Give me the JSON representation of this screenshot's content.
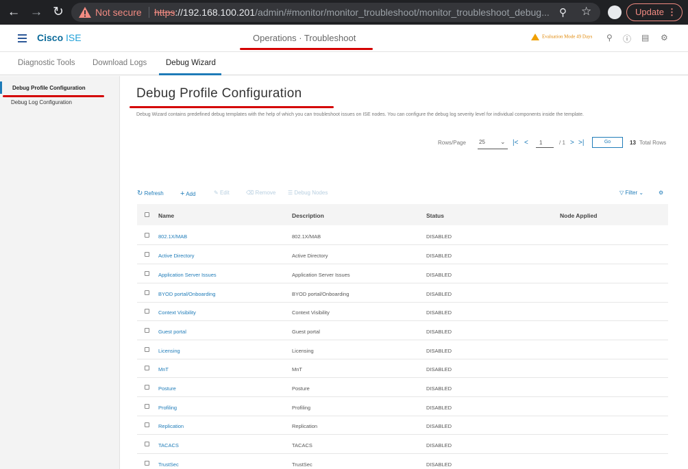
{
  "browser": {
    "security_label": "Not secure",
    "url_scheme": "https",
    "url_host": "://192.168.100.201",
    "url_path": "/admin/#monitor/monitor_troubleshoot/monitor_troubleshoot_debug...",
    "update_label": "Update"
  },
  "app": {
    "brand_cisco": "Cisco",
    "brand_product": "ISE",
    "page_heading": "Operations · Troubleshoot",
    "evaluation_notice": "Evaluation Mode 49 Days"
  },
  "subnav": {
    "tabs": [
      "Diagnostic Tools",
      "Download Logs",
      "Debug Wizard"
    ],
    "active_tab": "Debug Wizard"
  },
  "sidebar": {
    "items": [
      "Debug Profile Configuration",
      "Debug Log Configuration"
    ]
  },
  "main": {
    "title": "Debug Profile Configuration",
    "description": "Debug Wizard contains predefined debug templates with the help of which you can troubleshoot issues on ISE nodes. You can configure the debug log severity level for individual components inside the template."
  },
  "pager": {
    "rows_label": "Rows/Page",
    "rows_value": "25",
    "page_value": "1",
    "page_total": "/ 1",
    "go_label": "Go",
    "total_rows": "13",
    "total_label": "Total Rows"
  },
  "toolbar": {
    "refresh": "Refresh",
    "add": "Add",
    "edit": "Edit",
    "remove": "Remove",
    "debug_nodes": "Debug Nodes",
    "filter": "Filter"
  },
  "table": {
    "headers": [
      "Name",
      "Description",
      "Status",
      "Node Applied"
    ],
    "rows": [
      {
        "name": "802.1X/MAB",
        "description": "802.1X/MAB",
        "status": "DISABLED"
      },
      {
        "name": "Active Directory",
        "description": "Active Directory",
        "status": "DISABLED"
      },
      {
        "name": "Application Server Issues",
        "description": "Application Server Issues",
        "status": "DISABLED"
      },
      {
        "name": "BYOD portal/Onboarding",
        "description": "BYOD portal/Onboarding",
        "status": "DISABLED"
      },
      {
        "name": "Context Visibility",
        "description": "Context Visibility",
        "status": "DISABLED"
      },
      {
        "name": "Guest portal",
        "description": "Guest portal",
        "status": "DISABLED"
      },
      {
        "name": "Licensing",
        "description": "Licensing",
        "status": "DISABLED"
      },
      {
        "name": "MnT",
        "description": "MnT",
        "status": "DISABLED"
      },
      {
        "name": "Posture",
        "description": "Posture",
        "status": "DISABLED"
      },
      {
        "name": "Profiling",
        "description": "Profiling",
        "status": "DISABLED"
      },
      {
        "name": "Replication",
        "description": "Replication",
        "status": "DISABLED"
      },
      {
        "name": "TACACS",
        "description": "TACACS",
        "status": "DISABLED"
      },
      {
        "name": "TrustSec",
        "description": "TrustSec",
        "status": "DISABLED"
      }
    ]
  },
  "colors": {
    "accent": "#1e7bb8",
    "annotation_red": "#d40000",
    "warning": "#f0a000"
  }
}
